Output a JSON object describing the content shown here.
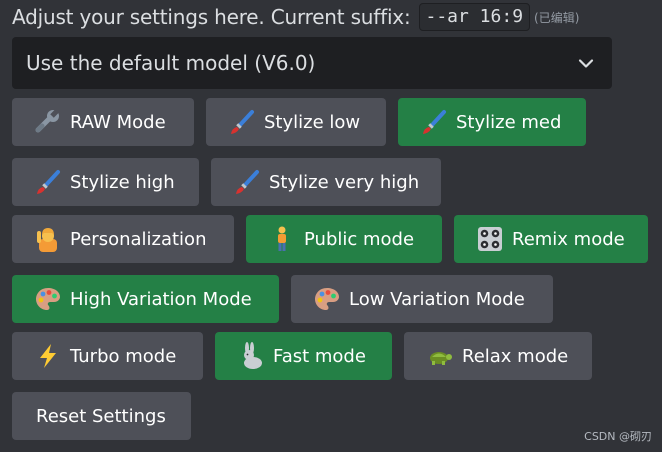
{
  "header": {
    "text": "Adjust your settings here. Current suffix:",
    "suffix": "--ar 16:9",
    "edited_label": "(已编辑)"
  },
  "model_select": {
    "selected": "Use the default model (V6.0)",
    "icon": "chevron-down-icon"
  },
  "buttons": [
    {
      "label": "RAW Mode",
      "icon": "wrench-icon",
      "active": false
    },
    {
      "label": "Stylize low",
      "icon": "paintbrush-icon",
      "active": false
    },
    {
      "label": "Stylize med",
      "icon": "paintbrush-icon",
      "active": true
    },
    {
      "label": "Stylize high",
      "icon": "paintbrush-icon",
      "active": false
    },
    {
      "label": "Stylize very high",
      "icon": "paintbrush-icon",
      "active": false
    },
    {
      "label": "Personalization",
      "icon": "person-raising-hand-icon",
      "active": false
    },
    {
      "label": "Public mode",
      "icon": "person-standing-icon",
      "active": true
    },
    {
      "label": "Remix mode",
      "icon": "control-knobs-icon",
      "active": true
    },
    {
      "label": "High Variation Mode",
      "icon": "artist-palette-icon",
      "active": true
    },
    {
      "label": "Low Variation Mode",
      "icon": "artist-palette-icon",
      "active": false
    },
    {
      "label": "Turbo mode",
      "icon": "lightning-icon",
      "active": false
    },
    {
      "label": "Fast mode",
      "icon": "rabbit-icon",
      "active": true
    },
    {
      "label": "Relax mode",
      "icon": "turtle-icon",
      "active": false
    },
    {
      "label": "Reset Settings",
      "icon": "",
      "active": false
    }
  ],
  "watermark": "CSDN @砌刃",
  "colors": {
    "background": "#313338",
    "button_gray": "#4e5058",
    "button_green": "#248046",
    "select_bg": "#1e1f22"
  }
}
